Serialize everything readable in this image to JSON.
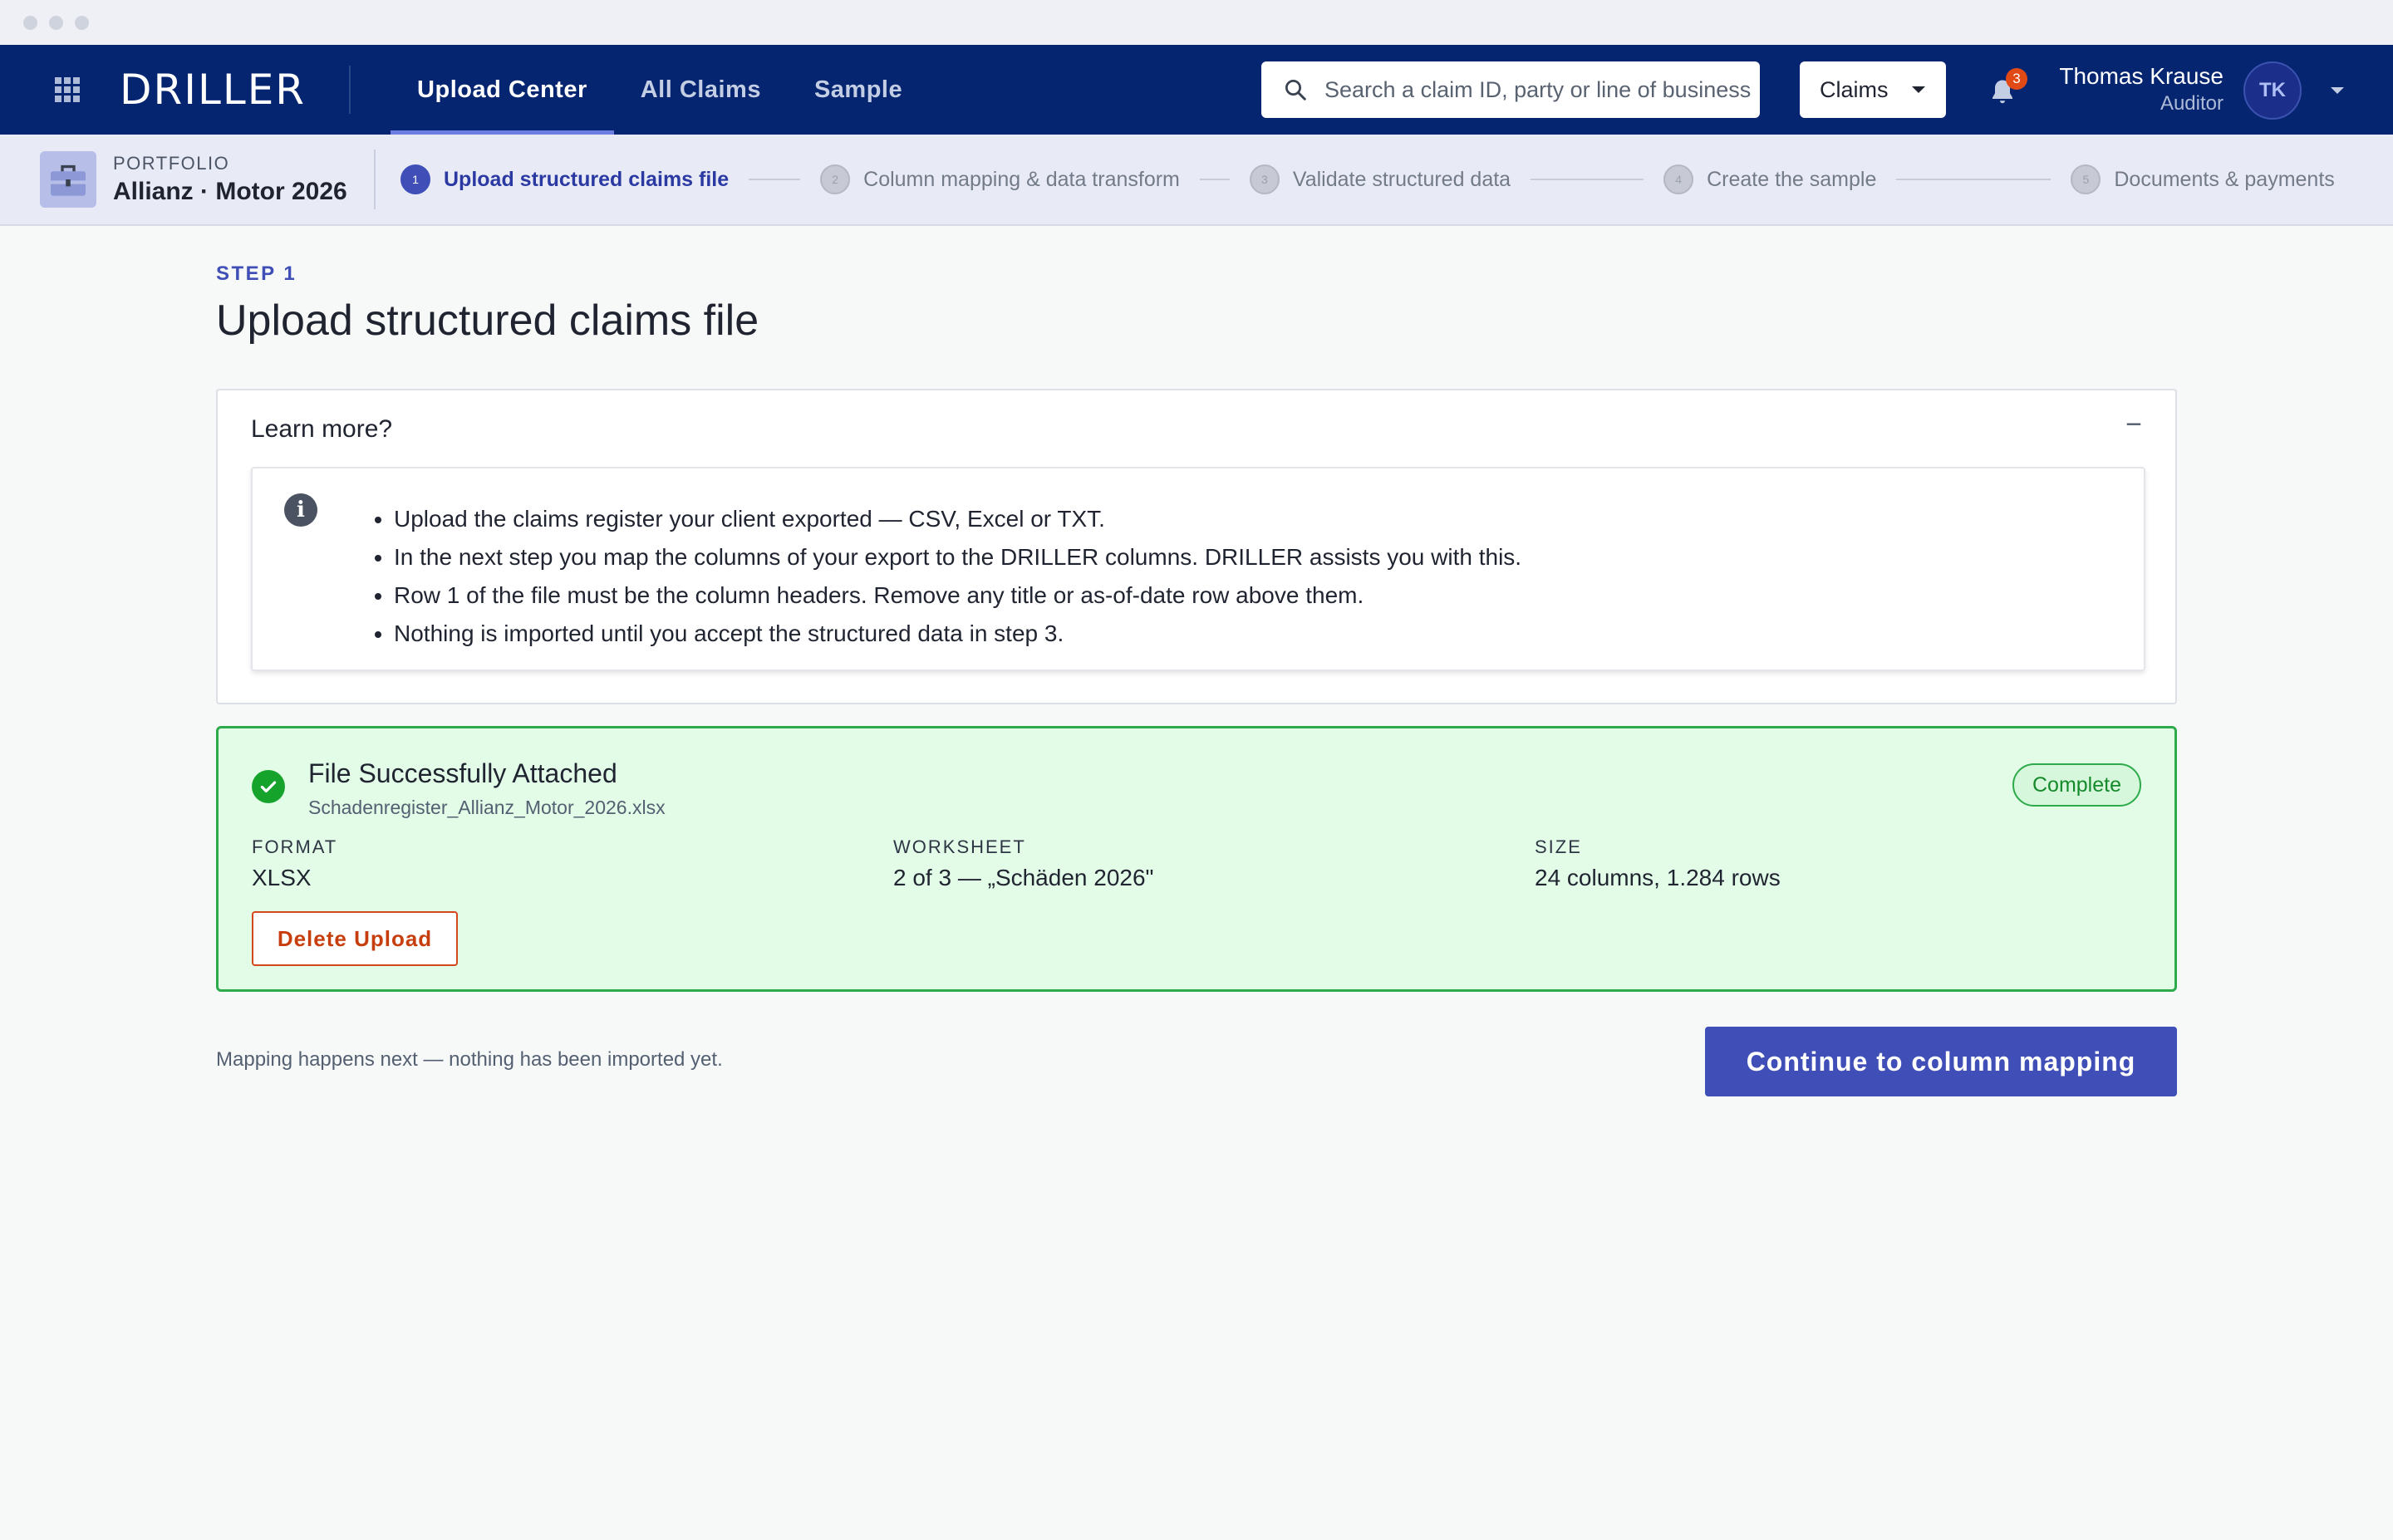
{
  "app": {
    "logo_text": "DRILLER",
    "nav_tabs": [
      {
        "label": "Upload Center",
        "active": true
      },
      {
        "label": "All Claims",
        "active": false
      },
      {
        "label": "Sample",
        "active": false
      }
    ],
    "search": {
      "placeholder": "Search a claim ID, party or line of business"
    },
    "scope_dropdown": {
      "value": "Claims"
    },
    "notifications": {
      "count": "3"
    },
    "user": {
      "name": "Thomas Krause",
      "role": "Auditor",
      "initials": "TK"
    }
  },
  "stepbar": {
    "portfolio_label": "PORTFOLIO",
    "portfolio_name": "Allianz · Motor 2026",
    "steps": [
      {
        "num": "1",
        "label": "Upload structured claims file",
        "active": true
      },
      {
        "num": "2",
        "label": "Column mapping & data transform",
        "active": false
      },
      {
        "num": "3",
        "label": "Validate structured data",
        "active": false
      },
      {
        "num": "4",
        "label": "Create the sample",
        "active": false
      },
      {
        "num": "5",
        "label": "Documents & payments",
        "active": false
      }
    ]
  },
  "main": {
    "step_kicker": "STEP 1",
    "title": "Upload structured claims file",
    "learn_more": {
      "heading": "Learn more?",
      "collapse_symbol": "−",
      "info_icon": "info-icon",
      "bullets": [
        "Upload the claims register your client exported — CSV, Excel or TXT.",
        "In the next step you map the columns of your export to the DRILLER columns. DRILLER assists you with this.",
        "Row 1 of the file must be the column headers. Remove any title or as-of-date row above them.",
        "Nothing is imported until you accept the structured data in step 3."
      ]
    },
    "upload_result": {
      "title": "File Successfully Attached",
      "filename": "Schadenregister_Allianz_Motor_2026.xlsx",
      "status": "Complete",
      "format_label": "FORMAT",
      "format_value": "XLSX",
      "worksheet_label": "WORKSHEET",
      "worksheet_value": "2 of 3 — „Schäden 2026\"",
      "size_label": "SIZE",
      "size_value": "24 columns, 1.284 rows",
      "delete_label": "Delete Upload"
    },
    "footer_note": "Mapping happens next — nothing has been imported yet.",
    "continue_label": "Continue to column mapping"
  },
  "colors": {
    "nav_bg": "#052570",
    "accent": "#3f4fb7",
    "success_border": "#2dab4a",
    "success_bg": "#e2fce7",
    "danger": "#c73e0e"
  }
}
